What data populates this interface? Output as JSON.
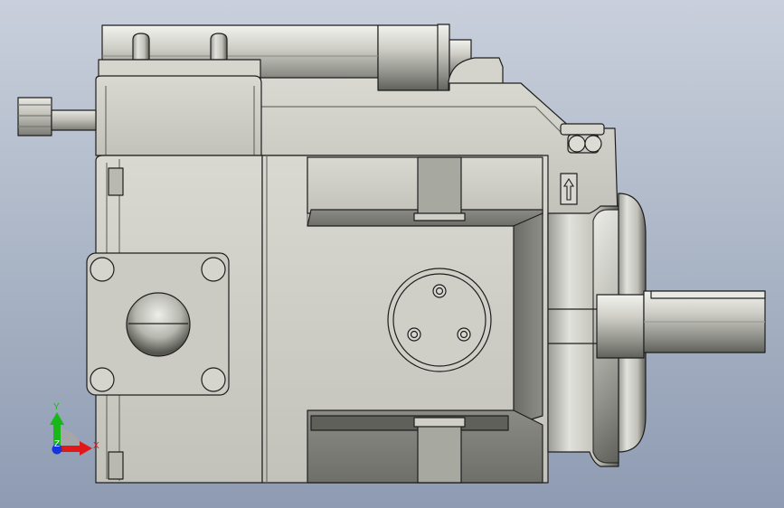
{
  "viewport": {
    "background_top": "#c9d0dc",
    "background_bottom": "#8e9bb2",
    "part_fill": "#c8c8c0",
    "part_dark": "#6f716b",
    "outline": "#1e1e1e"
  },
  "triad": {
    "x_label": "X",
    "y_label": "Y",
    "z_label": "Z",
    "x_color": "#e01010",
    "y_color": "#10b010",
    "z_color": "#1030e0"
  },
  "flow_arrow_icon": "up-arrow-icon"
}
